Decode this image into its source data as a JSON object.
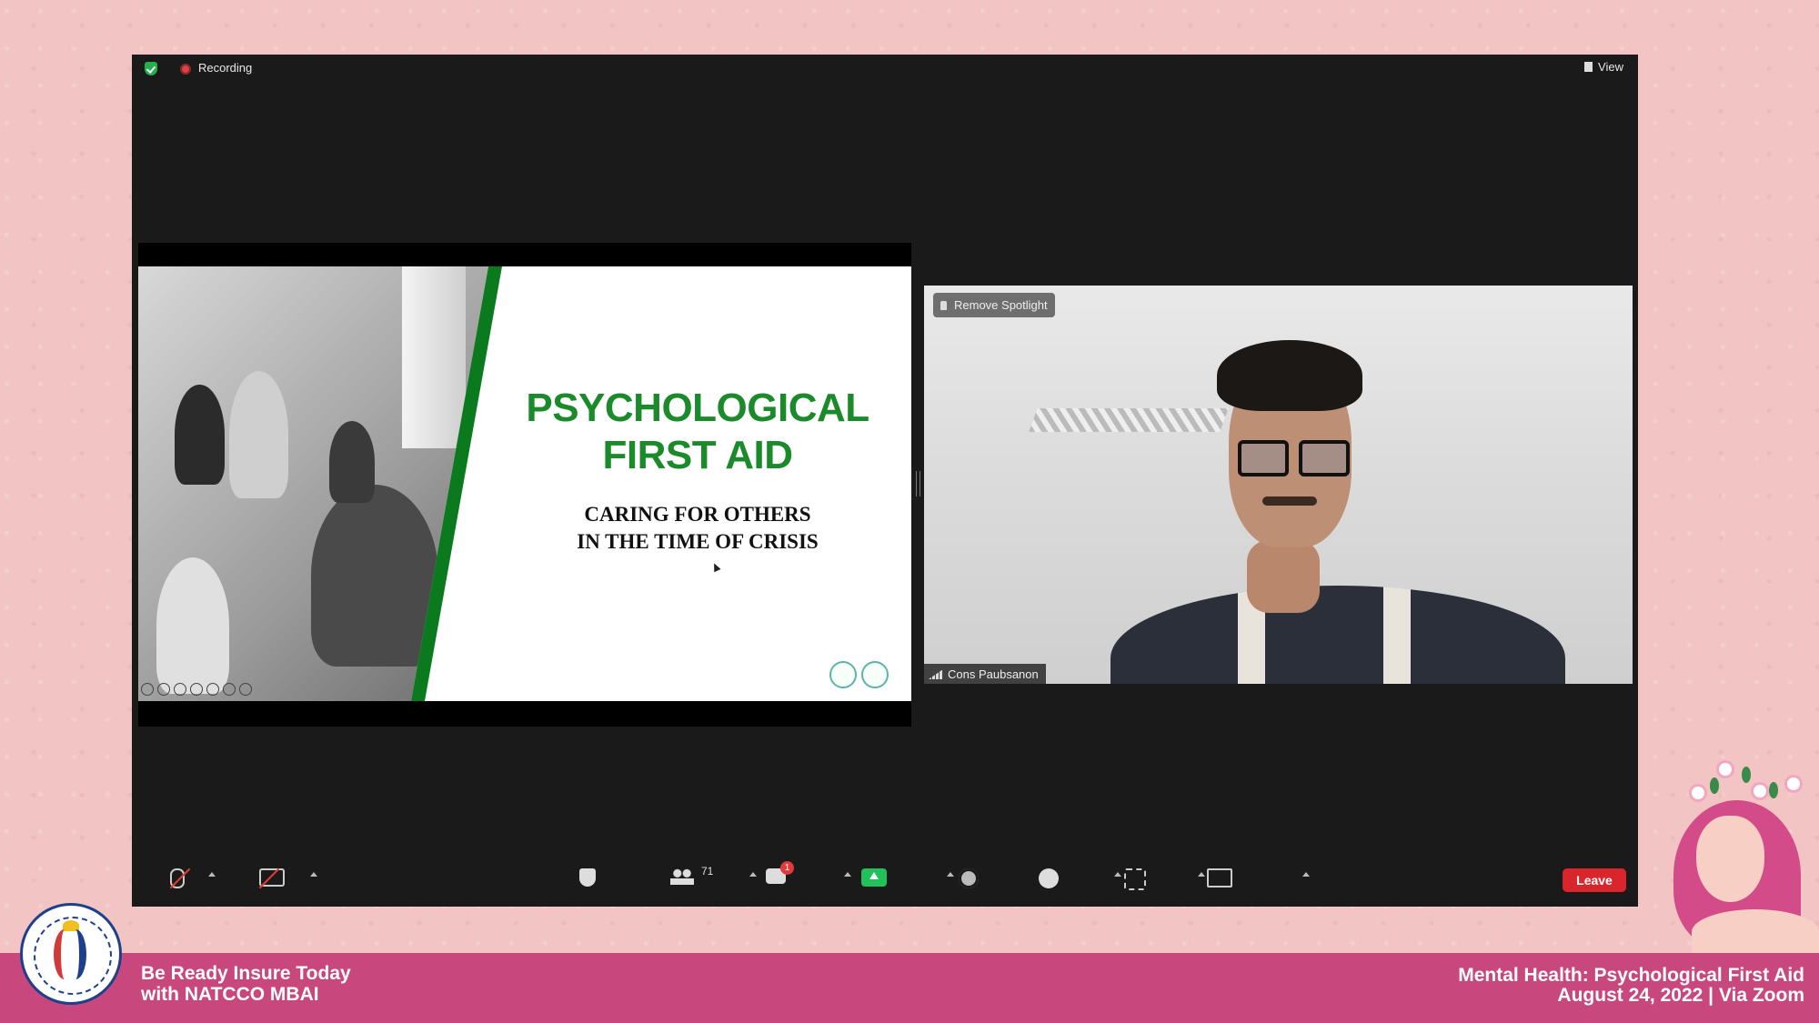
{
  "zoom": {
    "recording_label": "Recording",
    "view_label": "View"
  },
  "slide": {
    "title_line1": "PSYCHOLOGICAL",
    "title_line2": "FIRST AID",
    "subtitle_line1": "CARING FOR OTHERS",
    "subtitle_line2": "IN THE TIME OF CRISIS"
  },
  "video": {
    "spotlight_label": "Remove Spotlight",
    "participant_name": "Cons Paubsanon"
  },
  "toolbar": {
    "participants_count": "71",
    "chat_badge": "1",
    "leave_label": "Leave"
  },
  "banner": {
    "left_line1": "Be Ready Insure Today",
    "left_line2": "with NATCCO MBAI",
    "right_line1": "Mental Health: Psychological First Aid",
    "right_line2": "August 24, 2022 | Via Zoom"
  },
  "colors": {
    "banner": "#c8487e",
    "background": "#f2c4c4",
    "slide_title_green": "#1a8a2a",
    "leave_red": "#d9262c",
    "share_green": "#22c05a"
  },
  "icons": [
    "shield-icon",
    "record-icon",
    "view-icon",
    "pin-icon",
    "signal-icon",
    "mic-muted-icon",
    "camera-off-icon",
    "security-icon",
    "participants-icon",
    "chat-icon",
    "share-screen-icon",
    "record-button-icon",
    "reactions-icon",
    "apps-icon",
    "whiteboard-icon"
  ]
}
